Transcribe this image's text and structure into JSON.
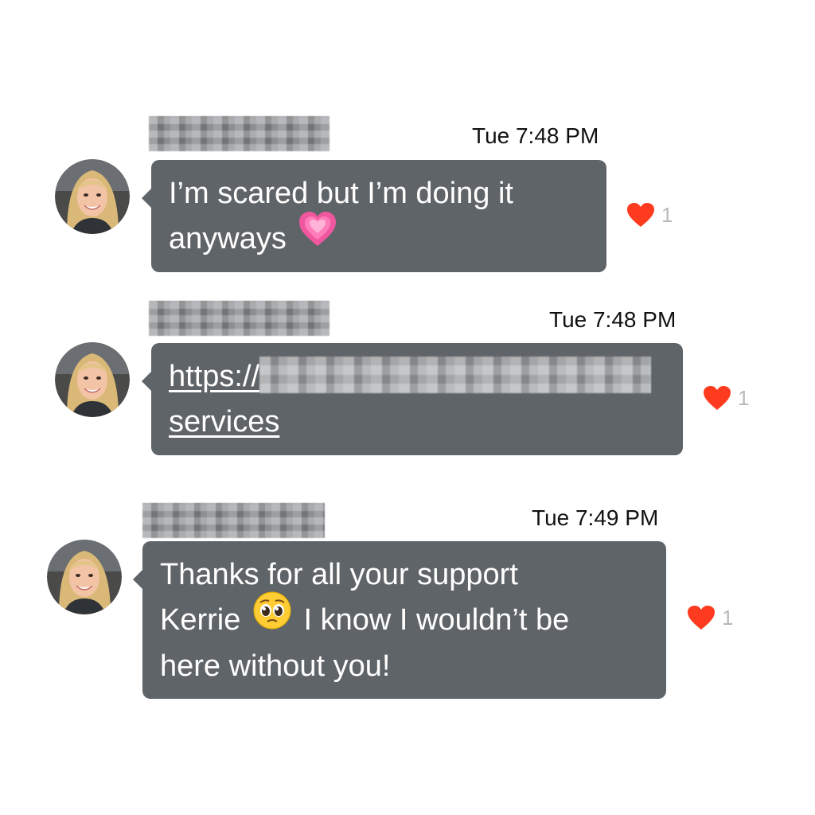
{
  "messages": [
    {
      "time": "Tue 7:48 PM",
      "lines": [
        "I’m scared but I’m doing it",
        "anyways"
      ],
      "emoji": "growing-heart-emoji",
      "likes": "1"
    },
    {
      "time": "Tue 7:48 PM",
      "link_prefix": "https://",
      "link_suffix": "services",
      "likes": "1"
    },
    {
      "time": "Tue 7:49 PM",
      "lines": [
        "Thanks for all your support",
        "Kerrie",
        "I know I wouldn’t be",
        "here without you!"
      ],
      "emoji": "pleading-face-emoji",
      "likes": "1"
    }
  ],
  "colors": {
    "bubble": "#5f6469",
    "heart": "#ff3b1f",
    "like_count": "#b9b9b9"
  }
}
